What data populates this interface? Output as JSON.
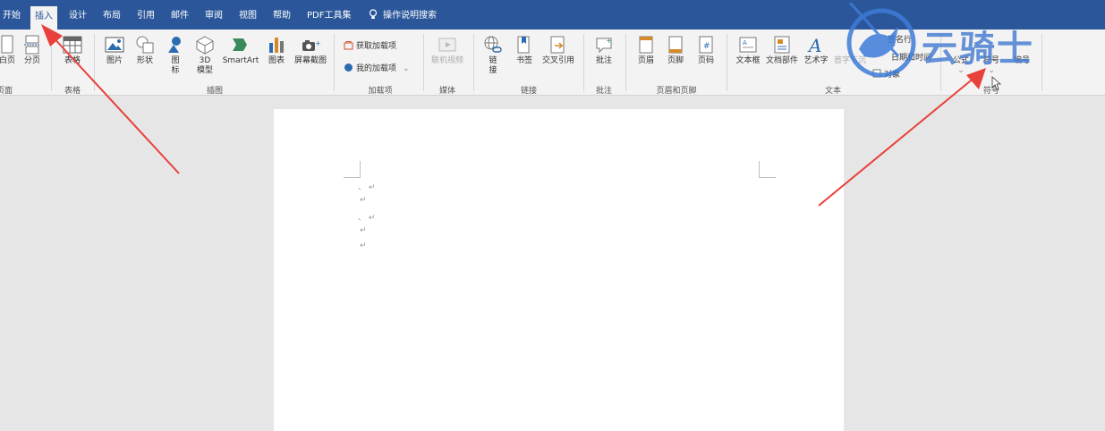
{
  "tabs": [
    "开始",
    "插入",
    "设计",
    "布局",
    "引用",
    "邮件",
    "审阅",
    "视图",
    "帮助",
    "PDF工具集"
  ],
  "tell_me": "操作说明搜索",
  "ribbon": {
    "pages": {
      "blank_page": "白页",
      "page_break": "分页",
      "group": "页面"
    },
    "table": {
      "table": "表格",
      "group": "表格"
    },
    "illustrations": {
      "pictures": "图片",
      "shapes": "形状",
      "icons_1": "图",
      "icons_2": "标",
      "models_1": "3D",
      "models_2": "模型",
      "smartart": "SmartArt",
      "chart": "图表",
      "screenshot": "屏幕截图",
      "group": "插图"
    },
    "addins": {
      "get": "获取加载项",
      "mine": "我的加载项",
      "group": "加载项"
    },
    "media": {
      "online_video": "联机视频",
      "group": "媒体"
    },
    "links": {
      "link_1": "链",
      "link_2": "接",
      "bookmark": "书签",
      "cross_ref": "交叉引用",
      "group": "链接"
    },
    "comments": {
      "comment": "批注",
      "group": "批注"
    },
    "header_footer": {
      "header": "页眉",
      "footer": "页脚",
      "page_number": "页码",
      "group": "页眉和页脚"
    },
    "text": {
      "textbox": "文本框",
      "quick_parts": "文档部件",
      "wordart": "艺术字",
      "dropcap": "首字下沉",
      "signature": "签名行",
      "datetime": "日期和时间",
      "object": "对象",
      "group": "文本"
    },
    "symbols": {
      "equation": "公式",
      "symbol": "符号",
      "numbering": "编号",
      "group": "符号"
    }
  },
  "watermark": "云骑士",
  "colors": {
    "tabbar": "#2b579a",
    "arrow": "#e8403a"
  }
}
